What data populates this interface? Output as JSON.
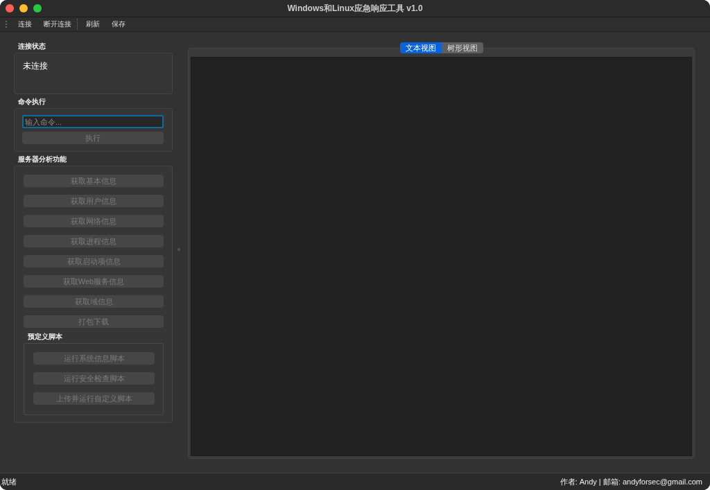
{
  "window": {
    "title": "Windows和Linux应急响应工具 v1.0"
  },
  "toolbar": [
    {
      "label": "连接",
      "separator_after": false
    },
    {
      "label": "断开连接",
      "separator_after": true
    },
    {
      "label": "刷新",
      "separator_after": false
    },
    {
      "label": "保存",
      "separator_after": false
    }
  ],
  "connection_status": {
    "title": "连接状态",
    "value": "未连接"
  },
  "command": {
    "title": "命令执行",
    "placeholder": "输入命令...",
    "focused": true,
    "button": {
      "label": "执行",
      "disabled": true
    }
  },
  "server_analysis": {
    "title": "服务器分析功能",
    "buttons": [
      {
        "label": "获取基本信息",
        "disabled": true
      },
      {
        "label": "获取用户信息",
        "disabled": true
      },
      {
        "label": "获取网络信息",
        "disabled": true
      },
      {
        "label": "获取进程信息",
        "disabled": true
      },
      {
        "label": "获取启动项信息",
        "disabled": true
      },
      {
        "label": "获取Web服务信息",
        "disabled": true
      },
      {
        "label": "获取域信息",
        "disabled": true
      },
      {
        "label": "打包下载",
        "disabled": true
      }
    ],
    "scripts": {
      "title": "预定义脚本",
      "buttons": [
        {
          "label": "运行系统信息脚本",
          "disabled": true
        },
        {
          "label": "运行安全检查脚本",
          "disabled": true
        },
        {
          "label": "上传并运行自定义脚本",
          "disabled": true
        }
      ]
    }
  },
  "view_tabs": [
    {
      "label": "文本视图",
      "selected": true
    },
    {
      "label": "树形视图",
      "selected": false
    }
  ],
  "status_bar": {
    "left": "就绪",
    "right": "作者: Andy | 邮箱: andyforsec@gmail.com"
  }
}
